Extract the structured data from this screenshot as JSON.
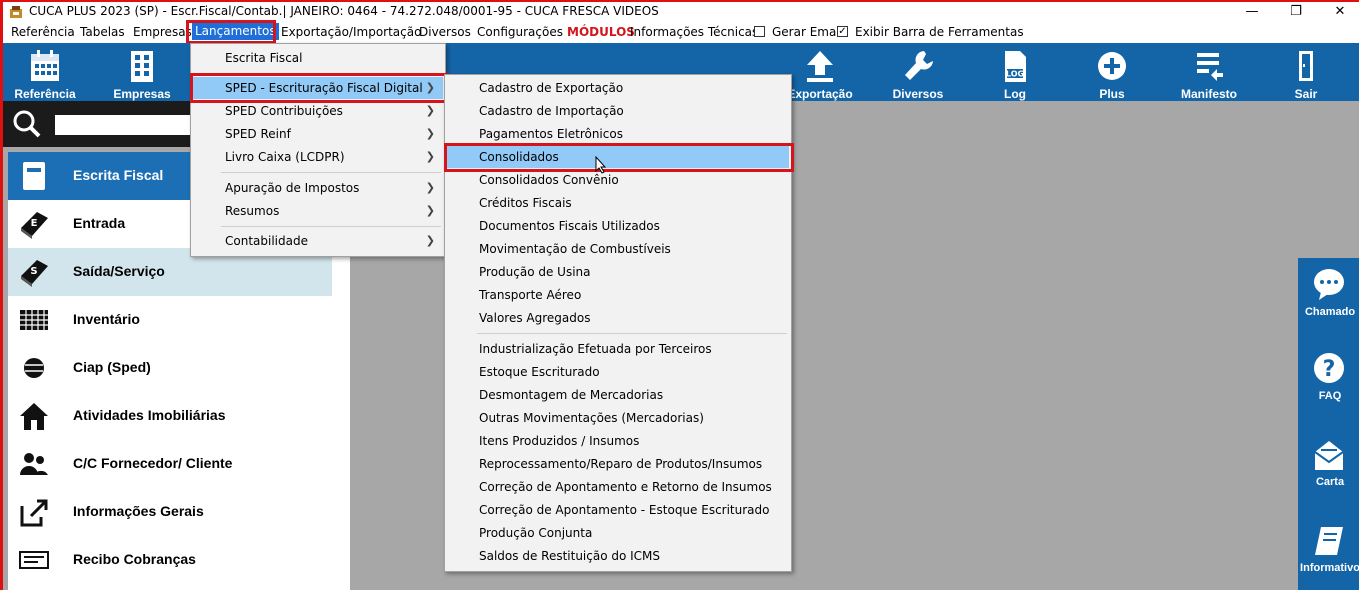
{
  "window": {
    "title": "CUCA PLUS 2023 (SP) - Escr.Fiscal/Contab.| JANEIRO: 0464 - 74.272.048/0001-95 - CUCA FRESCA VIDEOS",
    "minimize": "—",
    "restore": "❐",
    "close": "✕"
  },
  "menubar": {
    "items": [
      "Referência",
      "Tabelas",
      "Empresas",
      "Lançamentos",
      "Exportação/Importação",
      "Diversos",
      "Configurações",
      "MÓDULOS",
      "Informações Técnicas"
    ],
    "gerar_email": "Gerar Email",
    "gerar_email_checked": false,
    "exibir_barra": "Exibir Barra de Ferramentas",
    "exibir_barra_checked": true
  },
  "toolbar": {
    "items": [
      "Referência",
      "Empresas",
      "Exportação",
      "Diversos",
      "Log",
      "Plus",
      "Manifesto",
      "Sair"
    ],
    "icons": [
      "calendar-icon",
      "building-icon",
      "upload-icon",
      "wrench-icon",
      "log-file-icon",
      "plus-icon",
      "manifest-icon",
      "exit-door-icon"
    ]
  },
  "search": {
    "placeholder": ""
  },
  "sidebar": {
    "items": [
      {
        "label": "Escrita Fiscal",
        "icon": "book-icon"
      },
      {
        "label": "Entrada",
        "icon": "ledger-in-icon"
      },
      {
        "label": "Saída/Serviço",
        "icon": "ledger-out-icon"
      },
      {
        "label": "Inventário",
        "icon": "grid-icon"
      },
      {
        "label": "Ciap (Sped)",
        "icon": "disc-icon"
      },
      {
        "label": "Atividades Imobiliárias",
        "icon": "house-icon"
      },
      {
        "label": "C/C Fornecedor/ Cliente",
        "icon": "people-icon"
      },
      {
        "label": "Informações Gerais",
        "icon": "export-doc-icon"
      },
      {
        "label": "Recibo Cobranças",
        "icon": "receipt-icon"
      }
    ]
  },
  "lancamentos_menu": {
    "items": [
      "Escrita Fiscal",
      "SPED - Escrituração Fiscal Digital",
      "SPED Contribuições",
      "SPED Reinf",
      "Livro Caixa (LCDPR)",
      "Apuração de Impostos",
      "Resumos",
      "Contabilidade"
    ]
  },
  "sped_submenu": {
    "items": [
      "Cadastro de Exportação",
      "Cadastro de Importação",
      "Pagamentos Eletrônicos",
      "Consolidados",
      "Consolidados Convênio",
      "Créditos Fiscais",
      "Documentos Fiscais Utilizados",
      "Movimentação de Combustíveis",
      "Produção de Usina",
      "Transporte Aéreo",
      "Valores Agregados",
      "Industrialização Efetuada por Terceiros",
      "Estoque Escriturado",
      "Desmontagem de Mercadorias",
      "Outras Movimentações (Mercadorias)",
      "Itens Produzidos / Insumos",
      "Reprocessamento/Reparo de Produtos/Insumos",
      "Correção de Apontamento e Retorno de Insumos",
      "Correção de Apontamento - Estoque Escriturado",
      "Produção Conjunta",
      "Saldos de Restituição do ICMS"
    ]
  },
  "dock": {
    "items": [
      "Chamado",
      "FAQ",
      "Carta",
      "Informativo"
    ]
  },
  "colors": {
    "toolbar": "#1465a8",
    "highlight": "#91c9f7",
    "annotation": "#d6141c"
  }
}
